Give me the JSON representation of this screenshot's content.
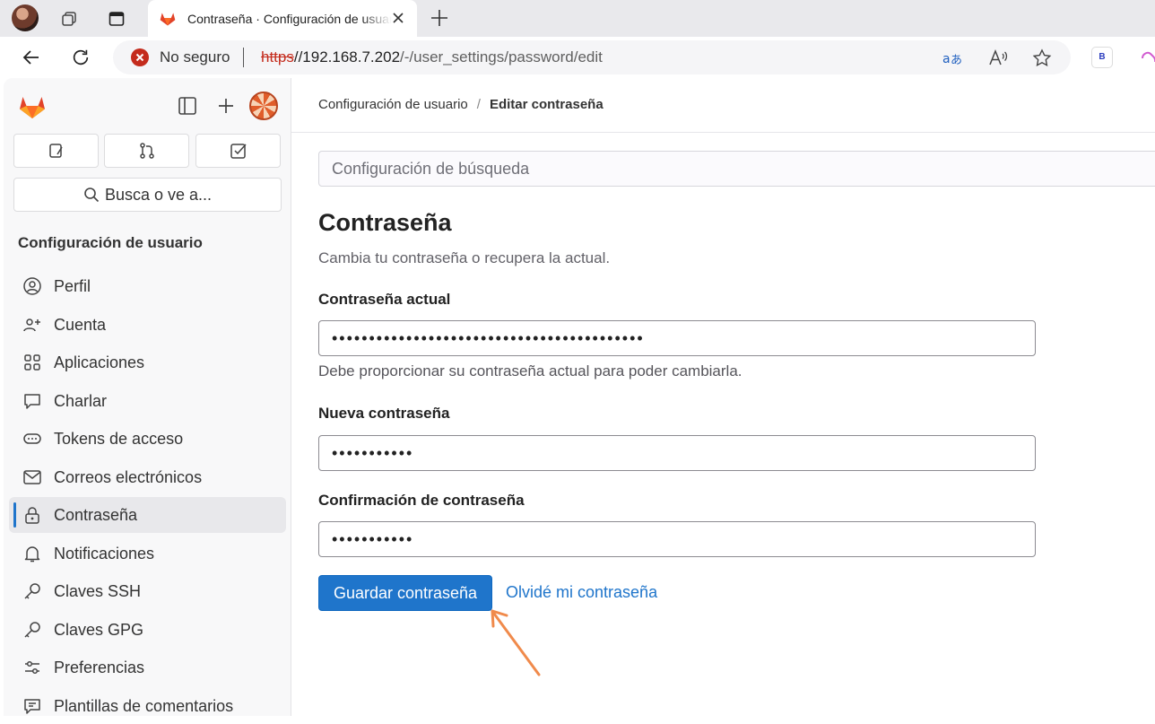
{
  "browser": {
    "tab_title": "Contraseña · Configuración de usuario · GitLab",
    "security_label": "No seguro",
    "url_scheme": "https",
    "url_host": "//192.168.7.202",
    "url_path": "/-/user_settings/password/edit",
    "extension_letter": "B"
  },
  "sidebar": {
    "search_label": "Busca o ve a...",
    "section_title": "Configuración de usuario",
    "items": [
      {
        "label": "Perfil",
        "icon": "profile-icon"
      },
      {
        "label": "Cuenta",
        "icon": "account-icon"
      },
      {
        "label": "Aplicaciones",
        "icon": "applications-icon"
      },
      {
        "label": "Charlar",
        "icon": "chat-icon"
      },
      {
        "label": "Tokens de acceso",
        "icon": "token-icon"
      },
      {
        "label": "Correos electrónicos",
        "icon": "mail-icon"
      },
      {
        "label": "Contraseña",
        "icon": "lock-icon",
        "active": true
      },
      {
        "label": "Notificaciones",
        "icon": "bell-icon"
      },
      {
        "label": "Claves SSH",
        "icon": "key-icon"
      },
      {
        "label": "Claves GPG",
        "icon": "key-icon"
      },
      {
        "label": "Preferencias",
        "icon": "preferences-icon"
      },
      {
        "label": "Plantillas de comentarios",
        "icon": "comment-template-icon"
      }
    ]
  },
  "breadcrumb": {
    "parent": "Configuración de usuario",
    "separator": "/",
    "current": "Editar contraseña"
  },
  "main": {
    "search_placeholder": "Configuración de búsqueda",
    "title": "Contraseña",
    "subtitle": "Cambia tu contraseña o recupera la actual.",
    "current_password_label": "Contraseña actual",
    "current_password_value": "••••••••••••••••••••••••••••••••••••••••••",
    "current_password_help": "Debe proporcionar su contraseña actual para poder cambiarla.",
    "new_password_label": "Nueva contraseña",
    "new_password_value": "•••••••••••",
    "confirm_password_label": "Confirmación de contraseña",
    "confirm_password_value": "•••••••••••",
    "save_button": "Guardar contraseña",
    "forgot_link": "Olvidé mi contraseña"
  },
  "colors": {
    "accent": "#1f75cb",
    "annotation_arrow": "#f08a4b",
    "insecure": "#c42b1c"
  }
}
